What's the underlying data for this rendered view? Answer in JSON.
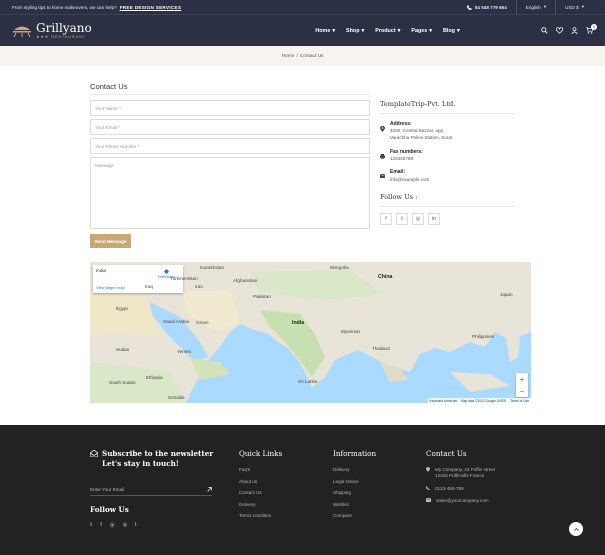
{
  "topbar": {
    "promo_text": "From styling tips to home makeovers, we can help?",
    "promo_link": "FREE DESIGN SERVICES",
    "phone": "54 548 779 654",
    "language": "English",
    "currency": "USD $"
  },
  "brand": {
    "name": "Grillyano",
    "tagline": "RESTAURANT"
  },
  "nav": [
    {
      "label": "Home"
    },
    {
      "label": "Shop"
    },
    {
      "label": "Product"
    },
    {
      "label": "Pages"
    },
    {
      "label": "Blog"
    }
  ],
  "cart_count": "0",
  "breadcrumb": {
    "home": "Home",
    "sep": "/",
    "current": "Contact Us"
  },
  "page_title": "Contact Us",
  "form": {
    "name_placeholder": "Your Name *",
    "email_placeholder": "Your Email *",
    "phone_placeholder": "Your Phone Number *",
    "message_placeholder": "Message",
    "send_label": "Send Message"
  },
  "company": {
    "name": "TemplateTrip-Pvt. Ltd.",
    "address_label": "Address:",
    "address_line1": "4030, Central Bazzar, opp.",
    "address_line2": "Varachha Police Station, Surat",
    "fax_label": "Fax numbers:",
    "fax": "123456789",
    "email_label": "Email:",
    "email": "info@example.com",
    "follow_label": "Follow Us :"
  },
  "map": {
    "place": "India",
    "directions": "Directions",
    "larger": "View larger map",
    "labels": {
      "china": "China",
      "india": "India",
      "afghanistan": "Afghanistan",
      "pakistan": "Pakistan",
      "iran": "Iran",
      "iraq": "Iraq",
      "egypt": "Egypt",
      "saudi": "Saudi Arabia",
      "sudan": "Sudan",
      "ethiopia": "Ethiopia",
      "yemen": "Yemen",
      "oman": "Oman",
      "south_sudan": "South Sudan",
      "somalia": "Somalia",
      "thailand": "Thailand",
      "myanmar": "Myanmar",
      "philippines": "Philippines",
      "sri_lanka": "Sri Lanka",
      "kazakhstan": "Kazakhstan",
      "mongolia": "Mongolia",
      "turkmenistan": "Turkmenistan",
      "japan": "Japan"
    },
    "attribution_keys": "Keyboard shortcuts",
    "attribution_data": "Map data ©2022 Google, INEGI",
    "attribution_terms": "Terms of Use"
  },
  "footer": {
    "newsletter_title": "Subscribe to the newsletter Let's stay in touch!",
    "email_placeholder": "Enter Your Email",
    "follow_title": "Follow Us",
    "quick_links_title": "Quick Links",
    "quick_links": [
      "Faq's",
      "About us",
      "Contact Us",
      "Delivery",
      "Terms condition"
    ],
    "information_title": "Information",
    "information_links": [
      "Delivery",
      "Legal Notice",
      "Shipping",
      "Wishlist",
      "Compare"
    ],
    "contact_title": "Contact Us",
    "contact_address1": "My Company, 42 Puffin street",
    "contact_address2": "12345 Puffinville France",
    "contact_phone": "0123-456-789",
    "contact_email": "sales@yourcompany.com"
  },
  "colors": {
    "header_bg": "#2b3044",
    "accent": "#c9a877",
    "footer_bg": "#222222"
  }
}
